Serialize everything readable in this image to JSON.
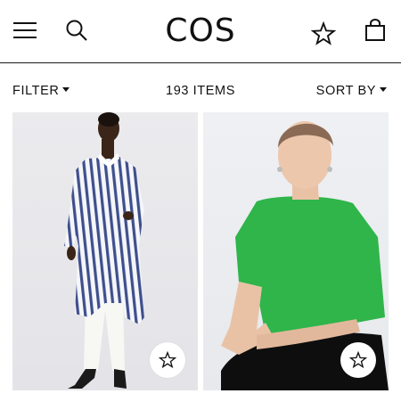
{
  "header": {
    "logo": "COS",
    "icons": [
      "menu-icon",
      "search-icon",
      "star-icon",
      "bag-icon"
    ]
  },
  "toolbar": {
    "filter_label": "FILTER",
    "items_count": "193 ITEMS",
    "sort_label": "SORT BY"
  },
  "products": [
    {
      "image": "striped-shirt-dress-photo",
      "wishlist_icon": "star-icon"
    },
    {
      "image": "green-tshirt-photo",
      "wishlist_icon": "star-icon"
    }
  ],
  "colors": {
    "text": "#111111",
    "background": "#ffffff",
    "stripe_blue": "#3f4f8c",
    "tshirt_green": "#2fb54a"
  }
}
